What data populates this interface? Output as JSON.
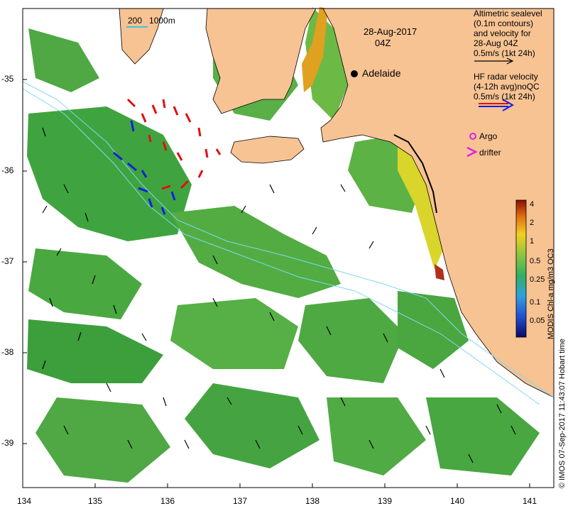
{
  "title": {
    "date": "28-Aug-2017",
    "time": "04Z"
  },
  "legend": {
    "scale_bar": "200   1000m",
    "altimetry_lines": [
      "Altimetric sealevel",
      "(0.1m contours)",
      "and velocity for",
      "28-Aug 04Z",
      "0.5m/s (1kt 24h)"
    ],
    "hf_radar_lines": [
      "HF radar velocity",
      "(4-12h avg)noQC",
      "0.5m/s (1kt 24h)"
    ],
    "argo_label": "Argo",
    "drifter_label": "drifter"
  },
  "place": {
    "name": "Adelaide"
  },
  "axes": {
    "x_ticks": [
      "134",
      "135",
      "136",
      "137",
      "138",
      "139",
      "140",
      "141"
    ],
    "y_ticks": [
      "-35",
      "-36",
      "-37",
      "-38",
      "-39"
    ]
  },
  "colorbar": {
    "label": "MODIS Chl-a mg/m3 OC3",
    "ticks": [
      "4",
      "2",
      "1",
      "0.5",
      "0.25",
      "0.1",
      "0.05"
    ]
  },
  "credit": "© IMOS 07-Sep-2017 11:43:07 Hobart time",
  "colors": {
    "land": "#f7c393",
    "chl_low": "#2f9a3c",
    "chl_mid": "#8cc63e",
    "chl_high": "#f0d020",
    "radar_red": "#e01010",
    "radar_blue": "#1020e0",
    "argo": "#e020e0"
  }
}
